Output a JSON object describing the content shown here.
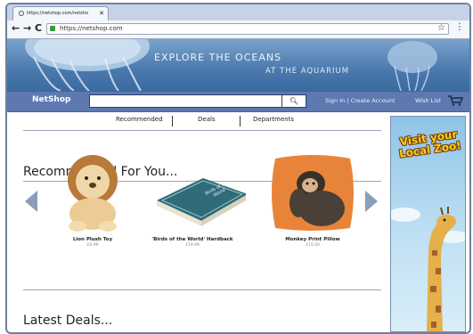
{
  "browser": {
    "tab_title": "https://netshop.com/netsho",
    "url": "https://netshop.com"
  },
  "hero": {
    "line1": "EXPLORE THE OCEANS",
    "line2": "AT THE AQUARIUM"
  },
  "nav": {
    "brand": "NetShop",
    "search_placeholder": "",
    "signin": "Sign In | Create Account",
    "wishlist": "Wish List"
  },
  "tabs": [
    "Recommended",
    "Deals",
    "Departments"
  ],
  "sections": {
    "recommended": "Recommended For You...",
    "deals": "Latest Deals..."
  },
  "products": [
    {
      "name": "Lion Plush Toy",
      "price": "£6.99"
    },
    {
      "name": "'Birds of the World' Hardback",
      "price": "£19.99"
    },
    {
      "name": "Monkey Print Pillow",
      "price": "£15.00"
    }
  ],
  "book_cover_text": "Birds of the World",
  "ad": {
    "text": "Visit your Local Zoo!"
  }
}
